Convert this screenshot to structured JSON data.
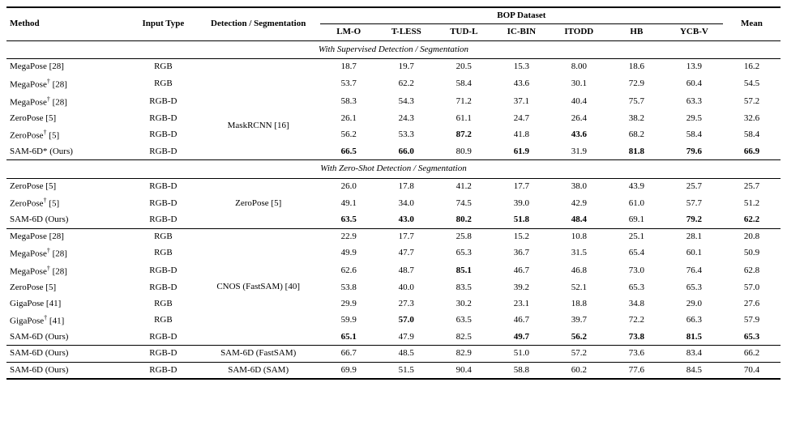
{
  "table": {
    "headers": {
      "method": "Method",
      "input_type": "Input Type",
      "detection": "Detection / Segmentation",
      "bop_dataset": "BOP Dataset",
      "cols": [
        "LM-O",
        "T-LESS",
        "TUD-L",
        "IC-BIN",
        "ITODD",
        "HB",
        "YCB-V"
      ],
      "mean": "Mean"
    },
    "section1": {
      "label": "With Supervised Detection / Segmentation",
      "detection_label": "MaskRCNN [16]",
      "rows": [
        {
          "method": "MegaPose [28]",
          "input": "RGB",
          "det": "",
          "lmo": "18.7",
          "tless": "19.7",
          "tudl": "20.5",
          "icbin": "15.3",
          "itodd": "8.00",
          "hb": "18.6",
          "ycbv": "13.9",
          "mean": "16.2"
        },
        {
          "method": "MegaPose† [28]",
          "input": "RGB",
          "det": "",
          "lmo": "53.7",
          "tless": "62.2",
          "tudl": "58.4",
          "icbin": "43.6",
          "itodd": "30.1",
          "hb": "72.9",
          "ycbv": "60.4",
          "mean": "54.5"
        },
        {
          "method": "MegaPose† [28]",
          "input": "RGB-D",
          "det": "MaskRCNN [16]",
          "lmo": "58.3",
          "tless": "54.3",
          "tudl": "71.2",
          "icbin": "37.1",
          "itodd": "40.4",
          "hb": "75.7",
          "ycbv": "63.3",
          "mean": "57.2"
        },
        {
          "method": "ZeroPose [5]",
          "input": "RGB-D",
          "det": "",
          "lmo": "26.1",
          "tless": "24.3",
          "tudl": "61.1",
          "icbin": "24.7",
          "itodd": "26.4",
          "hb": "38.2",
          "ycbv": "29.5",
          "mean": "32.6"
        },
        {
          "method": "ZeroPose† [5]",
          "input": "RGB-D",
          "det": "",
          "lmo": "56.2",
          "tless": "53.3",
          "tudl": "87.2",
          "icbin": "41.8",
          "itodd": "43.6",
          "hb": "68.2",
          "ycbv": "58.4",
          "mean": "58.4",
          "bold_tudl": true,
          "bold_itodd": true
        },
        {
          "method": "SAM-6D* (Ours)",
          "input": "RGB-D",
          "det": "",
          "lmo": "66.5",
          "tless": "66.0",
          "tudl": "80.9",
          "icbin": "61.9",
          "itodd": "31.9",
          "hb": "81.8",
          "ycbv": "79.6",
          "mean": "66.9",
          "bold_lmo": true,
          "bold_tless": true,
          "bold_icbin": true,
          "bold_hb": true,
          "bold_ycbv": true,
          "bold_mean": true
        }
      ]
    },
    "section2": {
      "label": "With Zero-Shot Detection / Segmentation",
      "rows": [
        {
          "method": "ZeroPose [5]",
          "input": "RGB-D",
          "det": "ZeroPose [5]",
          "lmo": "26.0",
          "tless": "17.8",
          "tudl": "41.2",
          "icbin": "17.7",
          "itodd": "38.0",
          "hb": "43.9",
          "ycbv": "25.7",
          "mean": "25.7"
        },
        {
          "method": "ZeroPose† [5]",
          "input": "RGB-D",
          "det": "",
          "lmo": "49.1",
          "tless": "34.0",
          "tudl": "74.5",
          "icbin": "39.0",
          "itodd": "42.9",
          "hb": "61.0",
          "ycbv": "57.7",
          "mean": "51.2"
        },
        {
          "method": "SAM-6D (Ours)",
          "input": "RGB-D",
          "det": "",
          "lmo": "63.5",
          "tless": "43.0",
          "tudl": "80.2",
          "icbin": "51.8",
          "itodd": "48.4",
          "hb": "69.1",
          "ycbv": "79.2",
          "mean": "62.2",
          "bold_lmo": true,
          "bold_tless": true,
          "bold_tudl": true,
          "bold_icbin": true,
          "bold_itodd": true,
          "bold_ycbv": true,
          "bold_mean": true
        }
      ]
    },
    "section3": {
      "label": "",
      "detection_label": "CNOS (FastSAM) [40]",
      "rows": [
        {
          "method": "MegaPose [28]",
          "input": "RGB",
          "det": "",
          "lmo": "22.9",
          "tless": "17.7",
          "tudl": "25.8",
          "icbin": "15.2",
          "itodd": "10.8",
          "hb": "25.1",
          "ycbv": "28.1",
          "mean": "20.8"
        },
        {
          "method": "MegaPose† [28]",
          "input": "RGB",
          "det": "",
          "lmo": "49.9",
          "tless": "47.7",
          "tudl": "65.3",
          "icbin": "36.7",
          "itodd": "31.5",
          "hb": "65.4",
          "ycbv": "60.1",
          "mean": "50.9"
        },
        {
          "method": "MegaPose† [28]",
          "input": "RGB-D",
          "det": "",
          "lmo": "62.6",
          "tless": "48.7",
          "tudl": "85.1",
          "icbin": "46.7",
          "itodd": "46.8",
          "hb": "73.0",
          "ycbv": "76.4",
          "mean": "62.8",
          "bold_tudl": true
        },
        {
          "method": "ZeroPose [5]",
          "input": "RGB-D",
          "det": "CNOS (FastSAM) [40]",
          "lmo": "53.8",
          "tless": "40.0",
          "tudl": "83.5",
          "icbin": "39.2",
          "itodd": "52.1",
          "hb": "65.3",
          "ycbv": "65.3",
          "mean": "57.0"
        },
        {
          "method": "GigaPose [41]",
          "input": "RGB",
          "det": "",
          "lmo": "29.9",
          "tless": "27.3",
          "tudl": "30.2",
          "icbin": "23.1",
          "itodd": "18.8",
          "hb": "34.8",
          "ycbv": "29.0",
          "mean": "27.6"
        },
        {
          "method": "GigaPose† [41]",
          "input": "RGB",
          "det": "",
          "lmo": "59.9",
          "tless": "57.0",
          "tudl": "63.5",
          "icbin": "46.7",
          "itodd": "39.7",
          "hb": "72.2",
          "ycbv": "66.3",
          "mean": "57.9",
          "bold_tless": true
        },
        {
          "method": "SAM-6D (Ours)",
          "input": "RGB-D",
          "det": "",
          "lmo": "65.1",
          "tless": "47.9",
          "tudl": "82.5",
          "icbin": "49.7",
          "itodd": "56.2",
          "hb": "73.8",
          "ycbv": "81.5",
          "mean": "65.3",
          "bold_lmo": true,
          "bold_icbin": true,
          "bold_itodd": true,
          "bold_hb": true,
          "bold_ycbv": true,
          "bold_mean": true
        }
      ]
    },
    "section4": {
      "rows": [
        {
          "method": "SAM-6D (Ours)",
          "input": "RGB-D",
          "det": "SAM-6D (FastSAM)",
          "lmo": "66.7",
          "tless": "48.5",
          "tudl": "82.9",
          "icbin": "51.0",
          "itodd": "57.2",
          "hb": "73.6",
          "ycbv": "83.4",
          "mean": "66.2"
        },
        {
          "method": "SAM-6D (Ours)",
          "input": "RGB-D",
          "det": "SAM-6D (SAM)",
          "lmo": "69.9",
          "tless": "51.5",
          "tudl": "90.4",
          "icbin": "58.8",
          "itodd": "60.2",
          "hb": "77.6",
          "ycbv": "84.5",
          "mean": "70.4"
        }
      ]
    }
  }
}
